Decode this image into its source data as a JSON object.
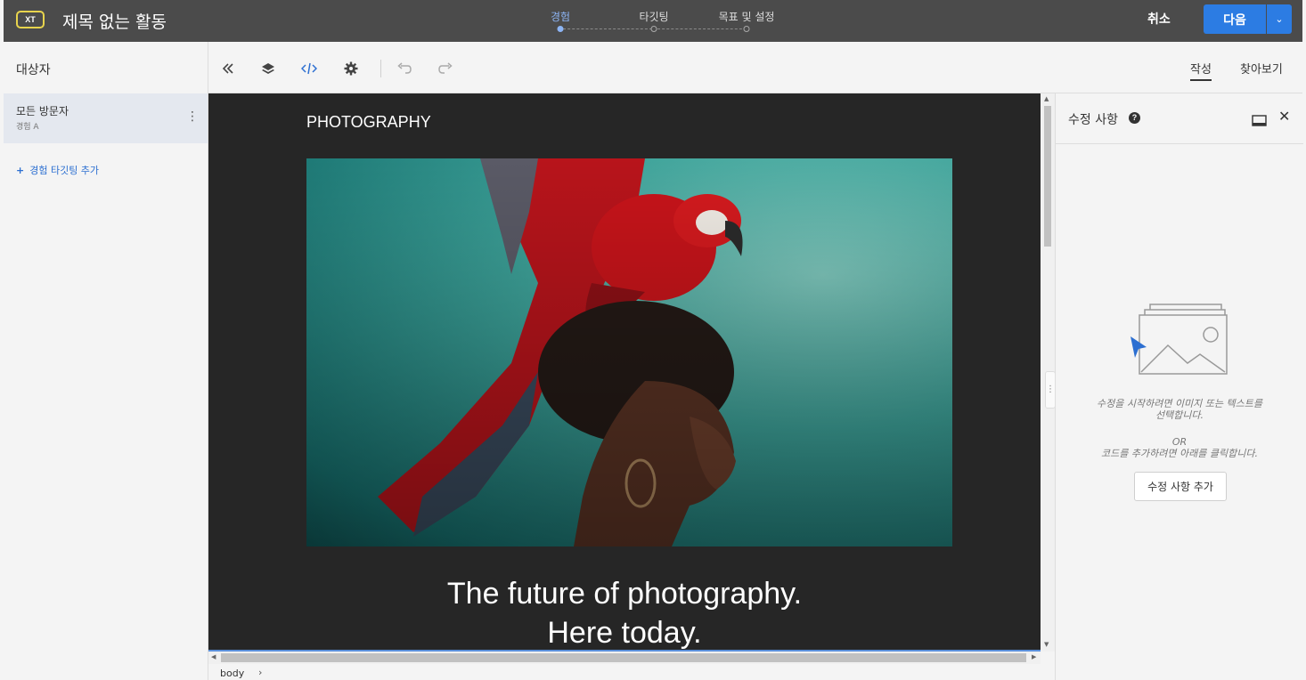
{
  "app": {
    "badge": "XT",
    "title": "제목 없는 활동"
  },
  "steps": [
    {
      "label": "경험",
      "active": true
    },
    {
      "label": "타깃팅",
      "active": false
    },
    {
      "label": "목표 및 설정",
      "active": false
    }
  ],
  "header": {
    "cancel_label": "취소",
    "next_label": "다음"
  },
  "left_panel": {
    "title": "대상자",
    "audience": {
      "name": "모든 방문자",
      "experience": "경험 A"
    },
    "add_targeting": "경험 타깃팅 추가"
  },
  "toolbar": {
    "icons": [
      "collapse-left-icon",
      "layers-icon",
      "code-icon",
      "settings-icon",
      "undo-icon",
      "redo-icon"
    ],
    "tabs": [
      {
        "label": "작성",
        "active": true
      },
      {
        "label": "찾아보기",
        "active": false
      }
    ]
  },
  "canvas": {
    "logo": "PHOTOGRAPHY",
    "headline_1": "The future of photography.",
    "headline_2": "Here today."
  },
  "status": {
    "breadcrumb": "body"
  },
  "right_panel": {
    "title": "수정 사항",
    "hint": "수정을 시작하려면 이미지 또는 텍스트를 선택합니다.",
    "or": "OR",
    "code_hint": "코드를 추가하려면 아래를 클릭합니다.",
    "add_button": "수정 사항 추가"
  },
  "colors": {
    "accent": "#2c7ce3",
    "topbar": "#4b4b4b",
    "step_active": "#8db5f5",
    "badge_border": "#e8d44d"
  }
}
